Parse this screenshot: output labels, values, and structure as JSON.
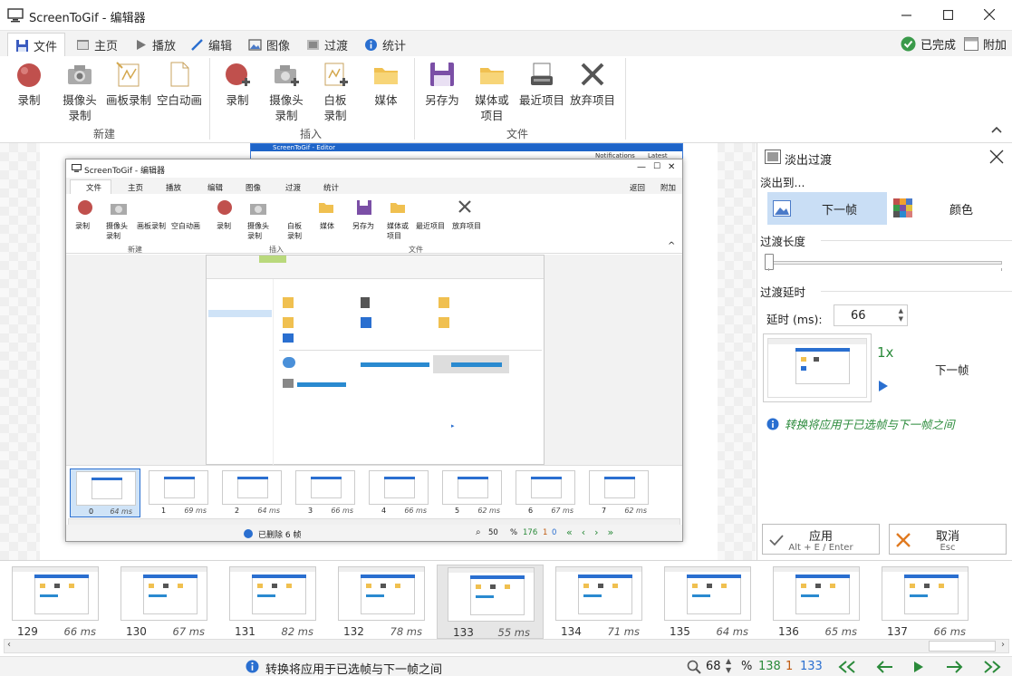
{
  "window": {
    "title": "ScreenToGif - 编辑器"
  },
  "tabs": [
    {
      "label": "文件",
      "icon": "save-icon"
    },
    {
      "label": "主页",
      "icon": "home-icon"
    },
    {
      "label": "播放",
      "icon": "play-icon"
    },
    {
      "label": "编辑",
      "icon": "pencil-icon"
    },
    {
      "label": "图像",
      "icon": "image-icon"
    },
    {
      "label": "过渡",
      "icon": "transition-icon"
    },
    {
      "label": "统计",
      "icon": "info-icon"
    }
  ],
  "tab_right": {
    "done": "已完成",
    "attach": "附加"
  },
  "ribbon": {
    "new_group": "新建",
    "insert_group": "插入",
    "file_group": "文件",
    "new": {
      "record": "录制",
      "webcam": "摄像头\n录制",
      "board": "画板录制",
      "blank": "空白动画"
    },
    "insert": {
      "record": "录制",
      "webcam": "摄像头\n录制",
      "board": "白板\n录制",
      "media": "媒体"
    },
    "file": {
      "save_as": "另存为",
      "media_project": "媒体或\n项目",
      "recent": "最近项目",
      "discard": "放弃项目"
    }
  },
  "inner_window": {
    "title": "ScreenToGif - 编辑器",
    "tabs": [
      "文件",
      "主页",
      "播放",
      "编辑",
      "图像",
      "过渡",
      "统计"
    ],
    "tab_right": [
      "返回",
      "附加"
    ],
    "groups": [
      "新建",
      "插入",
      "文件"
    ],
    "buttons": [
      "录制",
      "摄像头\n录制",
      "画板录制",
      "空白动画",
      "录制",
      "摄像头\n录制",
      "白板\n录制",
      "媒体",
      "另存为",
      "媒体或\n项目",
      "最近项目",
      "放弃项目"
    ],
    "frames": [
      {
        "n": "0",
        "ms": "64 ms"
      },
      {
        "n": "1",
        "ms": "69 ms"
      },
      {
        "n": "2",
        "ms": "64 ms"
      },
      {
        "n": "3",
        "ms": "66 ms"
      },
      {
        "n": "4",
        "ms": "66 ms"
      },
      {
        "n": "5",
        "ms": "62 ms"
      },
      {
        "n": "6",
        "ms": "67 ms"
      },
      {
        "n": "7",
        "ms": "62 ms"
      }
    ],
    "status_text": "已删除 6 帧",
    "zoom": "50",
    "percent": "%",
    "count": "176",
    "sel": "1",
    "cur": "0"
  },
  "bg_window": {
    "title": "ScreenToGif - Editor",
    "tabs": [
      "Notifications",
      "Latest"
    ]
  },
  "panel": {
    "title": "淡出过渡",
    "fade_to_label": "淡出到...",
    "next_frame_option": "下一帧",
    "color_option": "颜色",
    "length_label": "过渡长度",
    "delay_label": "过渡延时",
    "delay_field_label": "延时 (ms):",
    "delay_value": "66",
    "preview_speed": "1x",
    "preview_target": "下一帧",
    "hint": "转换将应用于已选帧与下一帧之间",
    "apply": {
      "label": "应用",
      "shortcut": "Alt + E / Enter"
    },
    "cancel": {
      "label": "取消",
      "shortcut": "Esc"
    }
  },
  "filmstrip": [
    {
      "n": "129",
      "ms": "66 ms"
    },
    {
      "n": "130",
      "ms": "67 ms"
    },
    {
      "n": "131",
      "ms": "82 ms"
    },
    {
      "n": "132",
      "ms": "78 ms"
    },
    {
      "n": "133",
      "ms": "55 ms",
      "selected": true
    },
    {
      "n": "134",
      "ms": "71 ms"
    },
    {
      "n": "135",
      "ms": "64 ms"
    },
    {
      "n": "136",
      "ms": "65 ms"
    },
    {
      "n": "137",
      "ms": "66 ms"
    }
  ],
  "status": {
    "hint": "转换将应用于已选帧与下一帧之间",
    "zoom": "68",
    "percent": "%",
    "total": "138",
    "selected": "1",
    "current": "133"
  },
  "colors": {
    "accent_blue": "#2a6fd0",
    "selected_bg": "#c9def5",
    "green_hint": "#2a8a3a",
    "record_red": "#c0504d"
  }
}
